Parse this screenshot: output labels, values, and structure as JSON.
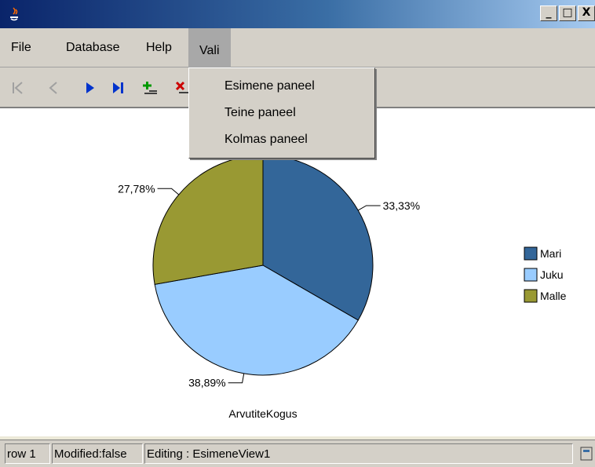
{
  "window": {
    "controls": [
      "_",
      "□",
      "X"
    ]
  },
  "menu": {
    "items": [
      "File",
      "Database",
      "Help",
      "Vali"
    ],
    "active": "Vali"
  },
  "dropdown": {
    "items": [
      "Esimene paneel",
      "Teine paneel",
      "Kolmas paneel"
    ]
  },
  "toolbar": {
    "buttons": [
      "first-icon",
      "previous-icon",
      "next-icon",
      "last-icon",
      "add-record-icon",
      "delete-record-icon"
    ]
  },
  "chart_data": {
    "type": "pie",
    "title": "ArvutiteKogus",
    "slices": [
      {
        "label": "Mari",
        "value": 33.33,
        "display": "33,33%",
        "color": "#336699"
      },
      {
        "label": "Juku",
        "value": 38.89,
        "display": "38,89%",
        "color": "#99ccff"
      },
      {
        "label": "Malle",
        "value": 27.78,
        "display": "27,78%",
        "color": "#999933"
      }
    ],
    "legend": {
      "placement": "right",
      "entries": [
        "Mari",
        "Juku",
        "Malle"
      ]
    }
  },
  "status": {
    "row": "row 1",
    "modified": "Modified:false",
    "editing": "Editing : EsimeneView1"
  }
}
